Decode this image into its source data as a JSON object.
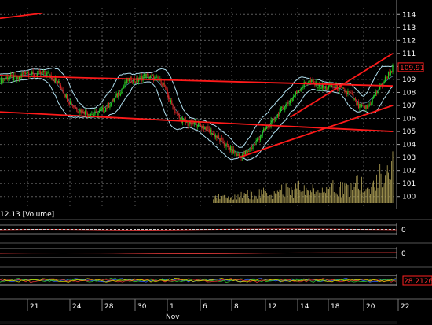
{
  "main_panel": {
    "volume_label": "12.13 [Volume]",
    "last_price_label": "109.91"
  },
  "indicator_panels": [
    {
      "value_label": "0"
    },
    {
      "value_label": "0"
    },
    {
      "value_label": "28.21265"
    }
  ],
  "x_axis": {
    "month_label": "Nov"
  },
  "colors": {
    "background": "#000000",
    "grid": "#5a5a5a",
    "candle_up": "#22cc22",
    "candle_down": "#cc2222",
    "bands": "#b0e0f0",
    "trendline": "#ff1a1a",
    "volume": "#b8a95a",
    "price_flag": "#ff2020"
  },
  "chart_data": {
    "type": "candlestick",
    "title": "",
    "xlabel": "",
    "ylabel": "",
    "ylim": [
      99.5,
      114.5
    ],
    "y_ticks": [
      100,
      101,
      102,
      103,
      104,
      105,
      106,
      107,
      108,
      109,
      110,
      111,
      112,
      113,
      114
    ],
    "x_tick_labels": [
      "21",
      "24",
      "28",
      "30",
      "1",
      "6",
      "8",
      "12",
      "14",
      "18",
      "20",
      "22"
    ],
    "last_price": 109.91,
    "price_series": [
      [
        0,
        108.9
      ],
      [
        4,
        109.2
      ],
      [
        8,
        109.0
      ],
      [
        12,
        109.6
      ],
      [
        16,
        109.3
      ],
      [
        20,
        109.5
      ],
      [
        24,
        109.3
      ],
      [
        28,
        108.6
      ],
      [
        32,
        107.4
      ],
      [
        36,
        106.7
      ],
      [
        40,
        106.5
      ],
      [
        44,
        106.3
      ],
      [
        48,
        106.6
      ],
      [
        52,
        107.2
      ],
      [
        56,
        108.0
      ],
      [
        60,
        109.0
      ],
      [
        64,
        108.9
      ],
      [
        68,
        109.3
      ],
      [
        72,
        109.1
      ],
      [
        76,
        108.8
      ],
      [
        80,
        107.2
      ],
      [
        84,
        106.0
      ],
      [
        88,
        105.6
      ],
      [
        92,
        105.6
      ],
      [
        96,
        105.3
      ],
      [
        100,
        104.8
      ],
      [
        104,
        104.2
      ],
      [
        108,
        103.6
      ],
      [
        112,
        103.1
      ],
      [
        116,
        103.4
      ],
      [
        120,
        104.2
      ],
      [
        124,
        105.1
      ],
      [
        128,
        105.8
      ],
      [
        132,
        106.7
      ],
      [
        136,
        107.4
      ],
      [
        140,
        108.2
      ],
      [
        144,
        108.9
      ],
      [
        148,
        108.6
      ],
      [
        152,
        108.3
      ],
      [
        156,
        108.5
      ],
      [
        160,
        108.2
      ],
      [
        164,
        107.9
      ],
      [
        168,
        106.9
      ],
      [
        172,
        106.8
      ],
      [
        176,
        107.9
      ],
      [
        180,
        108.9
      ],
      [
        184,
        109.9
      ]
    ],
    "volume_series": [
      [
        100,
        0.15
      ],
      [
        104,
        0.2
      ],
      [
        108,
        0.25
      ],
      [
        112,
        0.2
      ],
      [
        116,
        0.3
      ],
      [
        120,
        0.25
      ],
      [
        124,
        0.35
      ],
      [
        128,
        0.3
      ],
      [
        132,
        0.4
      ],
      [
        136,
        0.35
      ],
      [
        140,
        0.45
      ],
      [
        144,
        0.3
      ],
      [
        148,
        0.4
      ],
      [
        152,
        0.3
      ],
      [
        156,
        0.5
      ],
      [
        160,
        0.45
      ],
      [
        164,
        0.4
      ],
      [
        168,
        0.6
      ],
      [
        172,
        0.5
      ],
      [
        176,
        0.7
      ],
      [
        180,
        0.9
      ],
      [
        184,
        1.0
      ]
    ],
    "trendlines": [
      {
        "from": [
          0,
          109.3
        ],
        "to": [
          184,
          108.5
        ]
      },
      {
        "from": [
          0,
          106.5
        ],
        "to": [
          184,
          105.0
        ]
      },
      {
        "from": [
          112,
          103.0
        ],
        "to": [
          184,
          107.0
        ]
      },
      {
        "from": [
          136,
          106.1
        ],
        "to": [
          184,
          111.0
        ]
      },
      {
        "from": [
          0,
          113.7
        ],
        "to": [
          20,
          114.1
        ]
      }
    ]
  }
}
